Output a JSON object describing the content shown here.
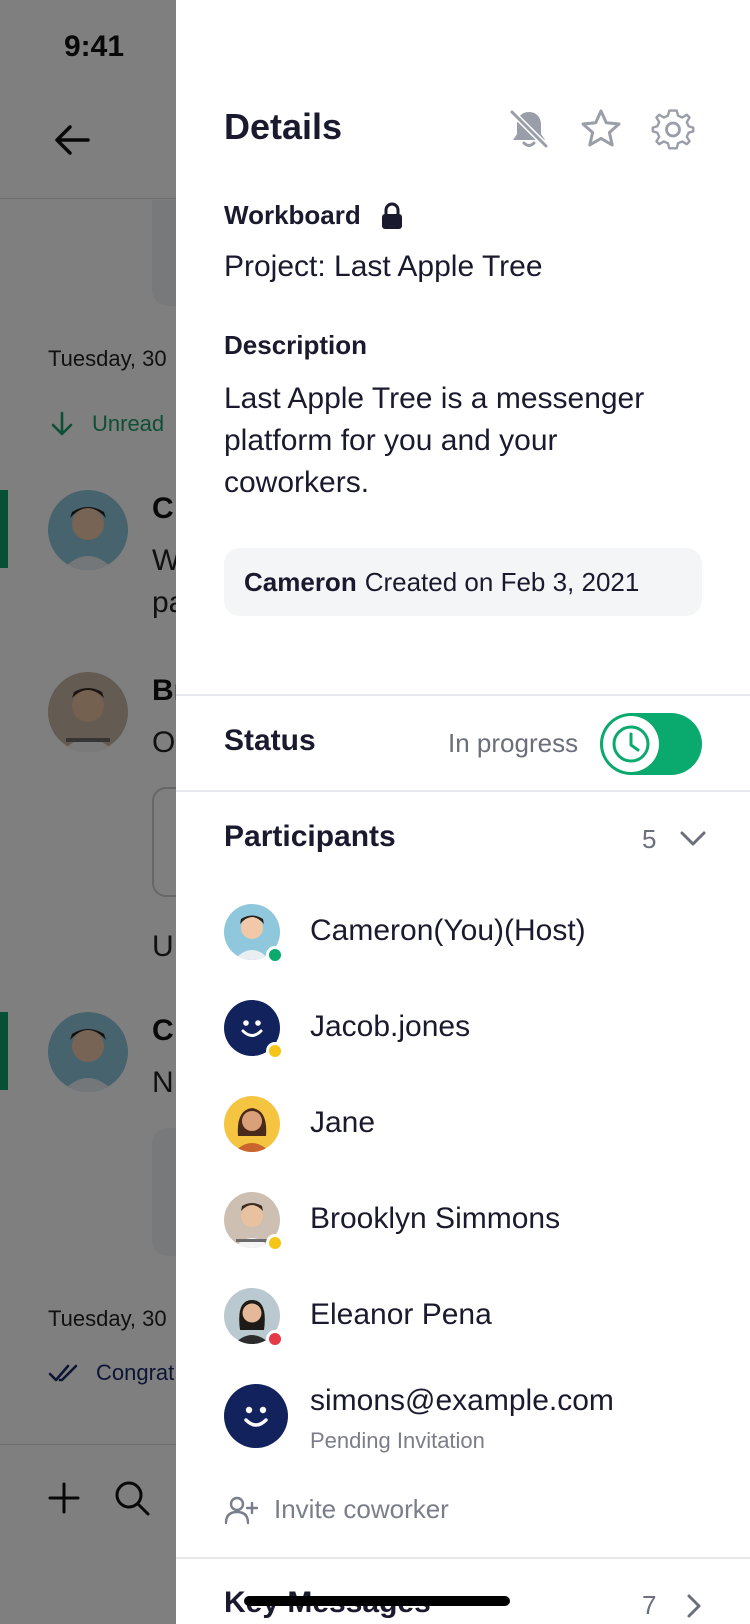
{
  "status_bar": {
    "time": "9:41"
  },
  "background_chat": {
    "date_1": "Tuesday, 30",
    "unread_label": "Unread",
    "message_1_name": "C",
    "message_1_text_line1": "W",
    "message_1_text_line2": "pa",
    "message_2_name": "Br",
    "message_2_text": "O",
    "message_3_text": "U",
    "message_4_name": "C",
    "message_4_text": "N",
    "date_2": "Tuesday, 30",
    "congrats_label": "Congrat"
  },
  "details": {
    "title": "Details",
    "workboard_label": "Workboard",
    "workboard_value": "Project: Last Apple Tree",
    "description_label": "Description",
    "description_text": "Last Apple Tree is a messenger platform for you and your coworkers.",
    "created_by": "Cameron",
    "created_text": "Created on Feb 3, 2021",
    "status_label": "Status",
    "status_value": "In progress",
    "status_toggle_on": true,
    "participants_label": "Participants",
    "participants_count": "5",
    "participants": [
      {
        "name": "Cameron(You)(Host)",
        "presence": "online",
        "presence_color": "#0aaa6e"
      },
      {
        "name": "Jacob.jones",
        "presence": "away",
        "presence_color": "#f5c518"
      },
      {
        "name": "Jane",
        "presence": "none",
        "presence_color": ""
      },
      {
        "name": "Brooklyn Simmons",
        "presence": "away",
        "presence_color": "#f5c518"
      },
      {
        "name": "Eleanor Pena",
        "presence": "busy",
        "presence_color": "#e53945"
      },
      {
        "name": "simons@example.com",
        "sub": "Pending Invitation"
      }
    ],
    "invite_label": "Invite coworker",
    "key_messages_label": "Key Messages",
    "key_messages_count": "7"
  },
  "colors": {
    "accent_green": "#0aaa6e",
    "navy": "#12225c",
    "overlay": "rgba(0,0,0,0.5)"
  }
}
